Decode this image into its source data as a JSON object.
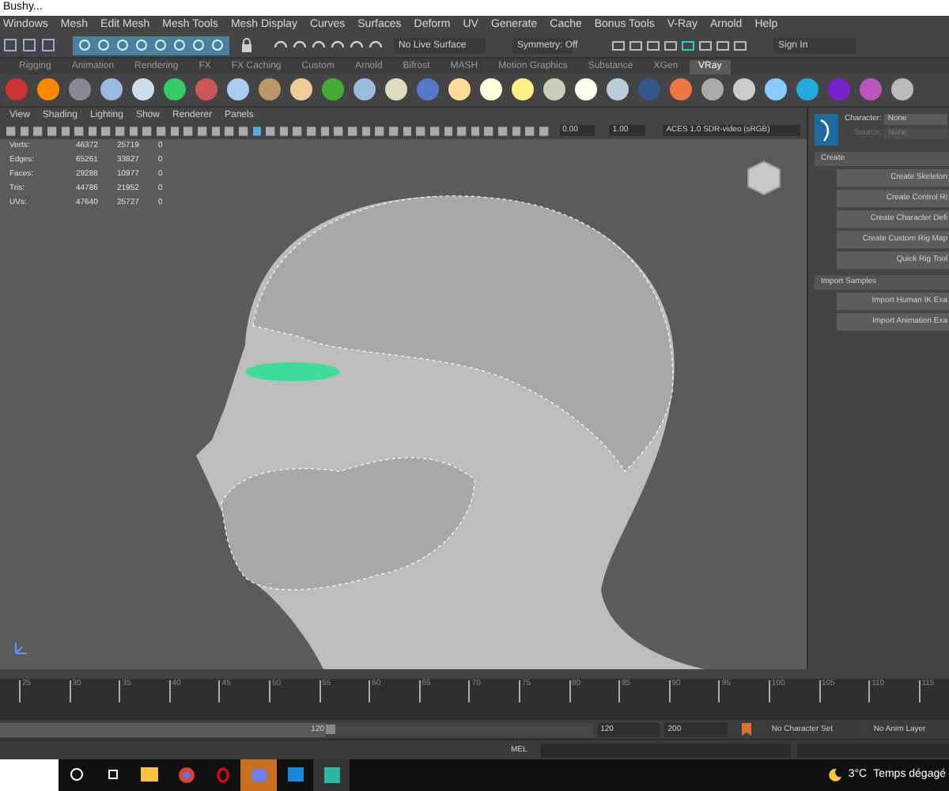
{
  "window": {
    "title": "Bushy..."
  },
  "menu_bar": [
    "Windows",
    "Mesh",
    "Edit Mesh",
    "Mesh Tools",
    "Mesh Display",
    "Curves",
    "Surfaces",
    "Deform",
    "UV",
    "Generate",
    "Cache",
    "Bonus Tools",
    "V-Ray",
    "Arnold",
    "Help"
  ],
  "status_line": {
    "live_surface": "No Live Surface",
    "symmetry": "Symmetry: Off",
    "account": "Sign In"
  },
  "shelf_tabs": [
    {
      "label": "Rigging",
      "selected": false
    },
    {
      "label": "Animation",
      "selected": false
    },
    {
      "label": "Rendering",
      "selected": false
    },
    {
      "label": "FX",
      "selected": false
    },
    {
      "label": "FX Caching",
      "selected": false
    },
    {
      "label": "Custom",
      "selected": false
    },
    {
      "label": "Arnold",
      "selected": false
    },
    {
      "label": "Bifrost",
      "selected": false
    },
    {
      "label": "MASH",
      "selected": false
    },
    {
      "label": "Motion Graphics",
      "selected": false
    },
    {
      "label": "Substance",
      "selected": false
    },
    {
      "label": "XGen",
      "selected": false
    },
    {
      "label": "VRay",
      "selected": true
    }
  ],
  "viewport": {
    "menu": [
      "View",
      "Shading",
      "Lighting",
      "Show",
      "Renderer",
      "Panels"
    ],
    "exposure": "0.00",
    "gamma": "1.00",
    "color_space": "ACES 1.0 SDR-video (sRGB)",
    "stats": [
      {
        "label": "Verts:",
        "values": [
          "46372",
          "25719",
          "0"
        ]
      },
      {
        "label": "Edges:",
        "values": [
          "65261",
          "33827",
          "0"
        ]
      },
      {
        "label": "Faces:",
        "values": [
          "29288",
          "10977",
          "0"
        ]
      },
      {
        "label": "Tris:",
        "values": [
          "44786",
          "21952",
          "0"
        ]
      },
      {
        "label": "UVs:",
        "values": [
          "47640",
          "25727",
          "0"
        ]
      }
    ]
  },
  "human_ik": {
    "character_label": "Character:",
    "character": "None",
    "source_label": "Source:",
    "source": "None",
    "sections": [
      {
        "title": "Create",
        "buttons": [
          "Create Skeleton",
          "Create Control Ri",
          "Create Character Defi",
          "Create Custom Rig Map",
          "Quick Rig Tool"
        ]
      },
      {
        "title": "Import Samples",
        "buttons": [
          "Import Human IK Exa",
          "Import Animation Exa"
        ]
      }
    ]
  },
  "timeline": {
    "ticks": [
      "25",
      "30",
      "35",
      "40",
      "45",
      "50",
      "55",
      "60",
      "65",
      "70",
      "75",
      "80",
      "85",
      "90",
      "95",
      "100",
      "105",
      "110",
      "115"
    ]
  },
  "range": {
    "level": 0.55,
    "slider_end": "120",
    "end": "120",
    "anim_end": "200",
    "character_set": "No Character Set",
    "anim_layer": "No Anim Layer"
  },
  "command_line": {
    "language": "MEL"
  },
  "taskbar": {
    "temperature": "3°C",
    "weather": "Temps dégagé"
  }
}
